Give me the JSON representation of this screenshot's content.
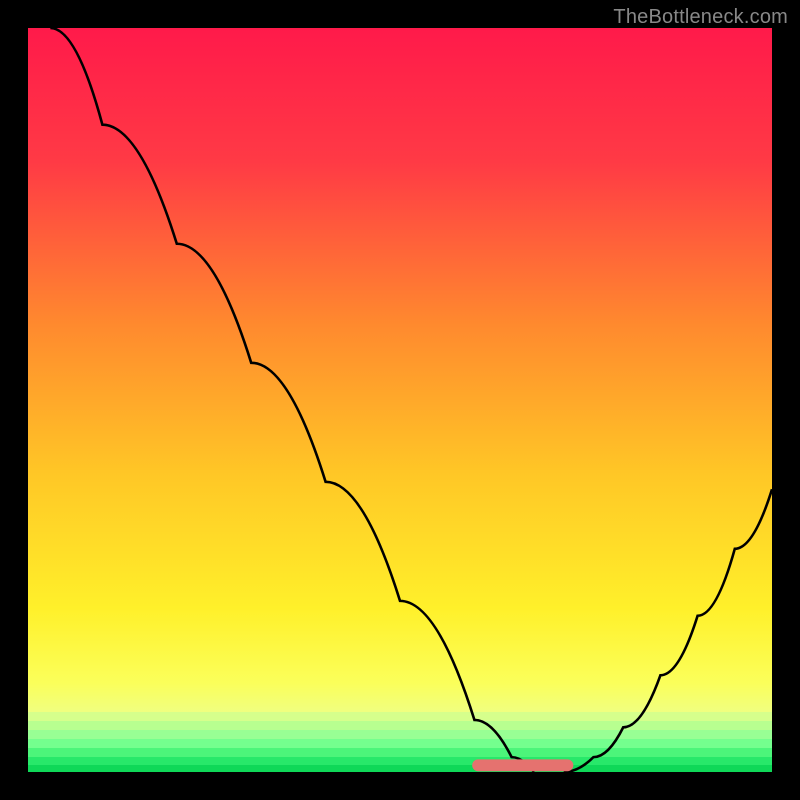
{
  "watermark": "TheBottleneck.com",
  "chart_data": {
    "type": "line",
    "title": "",
    "xlabel": "",
    "ylabel": "",
    "xlim": [
      0,
      100
    ],
    "ylim": [
      0,
      100
    ],
    "grid": false,
    "series": [
      {
        "name": "left-curve",
        "x": [
          3,
          10,
          20,
          30,
          40,
          50,
          60,
          65,
          68
        ],
        "y": [
          100,
          87,
          71,
          55,
          39,
          23,
          7,
          2,
          0
        ]
      },
      {
        "name": "right-curve",
        "x": [
          72,
          76,
          80,
          85,
          90,
          95,
          100
        ],
        "y": [
          0,
          2,
          6,
          13,
          21,
          30,
          38
        ]
      },
      {
        "name": "flat-highlight",
        "x": [
          60.5,
          72.5
        ],
        "y": [
          0,
          0
        ]
      }
    ],
    "gradient_stops": [
      {
        "pos": 0,
        "color": "#ff1a4a"
      },
      {
        "pos": 18,
        "color": "#ff3a45"
      },
      {
        "pos": 40,
        "color": "#ff8a2e"
      },
      {
        "pos": 60,
        "color": "#ffc726"
      },
      {
        "pos": 78,
        "color": "#fff02a"
      },
      {
        "pos": 88,
        "color": "#fbff5a"
      },
      {
        "pos": 92,
        "color": "#f0ff80"
      }
    ],
    "bottom_bands": [
      {
        "from": 92,
        "to": 93.2,
        "color": "#d6ff8c"
      },
      {
        "from": 93.2,
        "to": 94.4,
        "color": "#b8ff90"
      },
      {
        "from": 94.4,
        "to": 95.6,
        "color": "#98ff94"
      },
      {
        "from": 95.6,
        "to": 96.8,
        "color": "#74ff8e"
      },
      {
        "from": 96.8,
        "to": 98.0,
        "color": "#4cf57a"
      },
      {
        "from": 98.0,
        "to": 99.0,
        "color": "#28e86a"
      },
      {
        "from": 99.0,
        "to": 100,
        "color": "#0fd858"
      }
    ],
    "highlight_color": "#e5726f",
    "curve_color": "#000000"
  }
}
